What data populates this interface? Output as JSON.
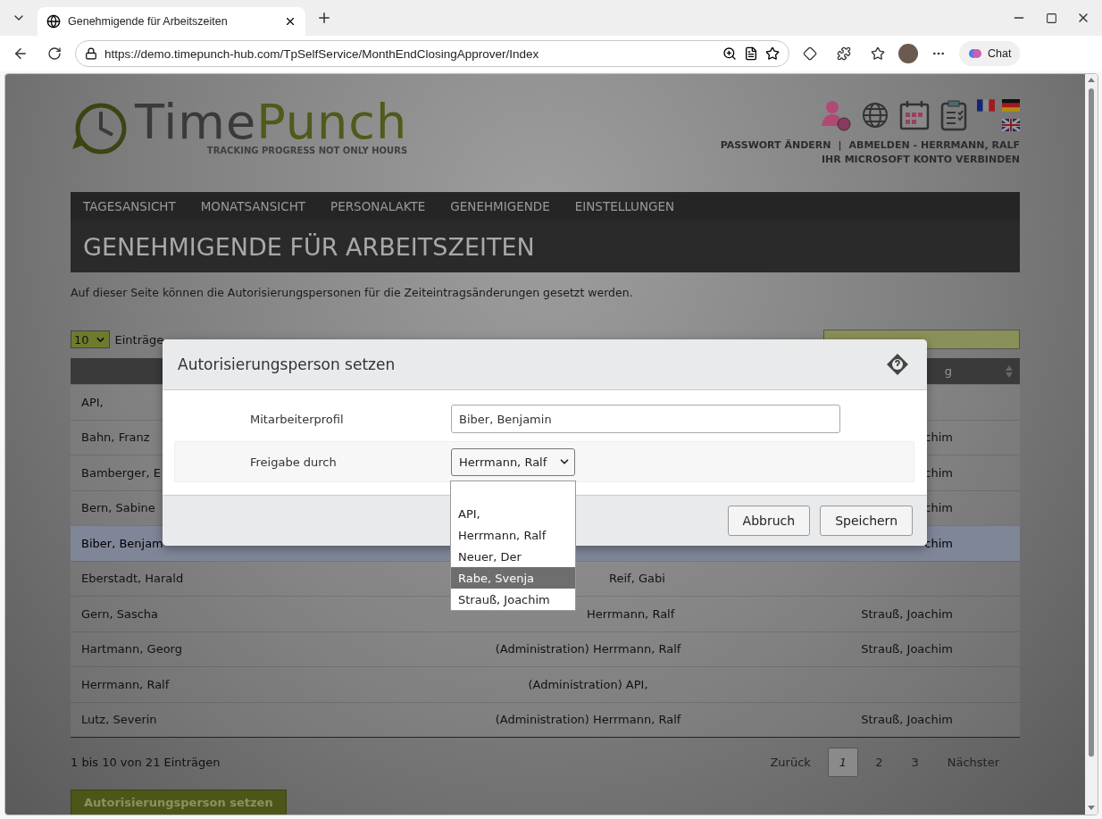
{
  "browser": {
    "tab_title": "Genehmigende für Arbeitszeiten",
    "url": "https://demo.timepunch-hub.com/TpSelfService/MonthEndClosingApprover/Index",
    "chat_label": "Chat"
  },
  "header": {
    "logo_parts": [
      "Time",
      "Punch"
    ],
    "tagline": "TRACKING PROGRESS NOT ONLY HOURS",
    "links": [
      "PASSWORT ÄNDERN",
      "|",
      "ABMELDEN - HERRMANN, RALF"
    ],
    "account_link": "IHR MICROSOFT KONTO VERBINDEN"
  },
  "nav": [
    "TAGESANSICHT",
    "MONATSANSICHT",
    "PERSONALAKTE",
    "GENEHMIGENDE",
    "EINSTELLUNGEN"
  ],
  "page_title": "GENEHMIGENDE FÜR ARBEITSZEITEN",
  "description": "Auf dieser Seite können die Autorisierungspersonen für die Zeiteintragsänderungen gesetzt werden.",
  "table_controls": {
    "page_size": "10",
    "page_size_label": "Einträge"
  },
  "table": {
    "column_3_header": "g",
    "rows": [
      {
        "selected": false,
        "cells": [
          {
            "text": "API,",
            "kind": "full"
          }
        ]
      },
      {
        "selected": false,
        "cells": [
          {
            "text": "Bahn, Franz",
            "kind": "full"
          },
          null,
          {
            "text": "chim",
            "kind": "full"
          }
        ]
      },
      {
        "selected": false,
        "cells": [
          {
            "text": "Bamberger, E",
            "kind": "full"
          },
          null,
          {
            "text": "chim",
            "kind": "full"
          }
        ]
      },
      {
        "selected": false,
        "cells": [
          {
            "text": "Bern, Sabine",
            "kind": "full"
          },
          null,
          {
            "text": "chim",
            "kind": "full"
          }
        ]
      },
      {
        "selected": true,
        "cells": [
          {
            "text": "Biber, Benjam",
            "kind": "full"
          },
          null,
          {
            "text": "chim",
            "kind": "full"
          }
        ]
      },
      {
        "selected": false,
        "cells": [
          {
            "text": "Eberstadt, Harald",
            "kind": "full"
          },
          {
            "text": "Reif, Gabi",
            "kind": "tail"
          }
        ]
      },
      {
        "selected": false,
        "cells": [
          {
            "text": "Gern, Sascha",
            "kind": "full"
          },
          {
            "text": "Herrmann, Ralf",
            "kind": "tail"
          },
          {
            "text": "Strauß, Joachim",
            "kind": "full"
          }
        ]
      },
      {
        "selected": false,
        "cells": [
          {
            "text": "Hartmann, Georg",
            "kind": "full"
          },
          {
            "text": "(Administration) Herrmann, Ralf",
            "kind": "full"
          },
          {
            "text": "Strauß, Joachim",
            "kind": "full"
          }
        ]
      },
      {
        "selected": false,
        "cells": [
          {
            "text": "Herrmann, Ralf",
            "kind": "full"
          },
          {
            "text": "(Administration) API,",
            "kind": "full"
          }
        ]
      },
      {
        "selected": false,
        "cells": [
          {
            "text": "Lutz, Severin",
            "kind": "full"
          },
          {
            "text": "(Administration) Herrmann, Ralf",
            "kind": "full"
          },
          {
            "text": "Strauß, Joachim",
            "kind": "full"
          }
        ]
      }
    ]
  },
  "footer": {
    "info": "1 bis 10 von 21 Einträgen",
    "pagination": [
      {
        "label": "Zurück",
        "selected": false
      },
      {
        "label": "1",
        "selected": true
      },
      {
        "label": "2",
        "selected": false
      },
      {
        "label": "3",
        "selected": false
      },
      {
        "label": "Nächster",
        "selected": false
      }
    ],
    "action_button": "Autorisierungsperson setzen"
  },
  "modal": {
    "title": "Autorisierungsperson setzen",
    "fields": [
      {
        "label": "Mitarbeiterprofil",
        "kind": "text",
        "value": "Biber, Benjamin"
      },
      {
        "label": "Freigabe durch",
        "kind": "select",
        "value": "Herrmann, Ralf"
      }
    ],
    "options": [
      {
        "label": "API,",
        "selected": false
      },
      {
        "label": "Herrmann, Ralf",
        "selected": false
      },
      {
        "label": "Neuer, Der",
        "selected": false
      },
      {
        "label": "Rabe, Svenja",
        "selected": true
      },
      {
        "label": "Strauß, Joachim",
        "selected": false
      }
    ],
    "buttons": [
      "Abbruch",
      "Speichern"
    ]
  }
}
